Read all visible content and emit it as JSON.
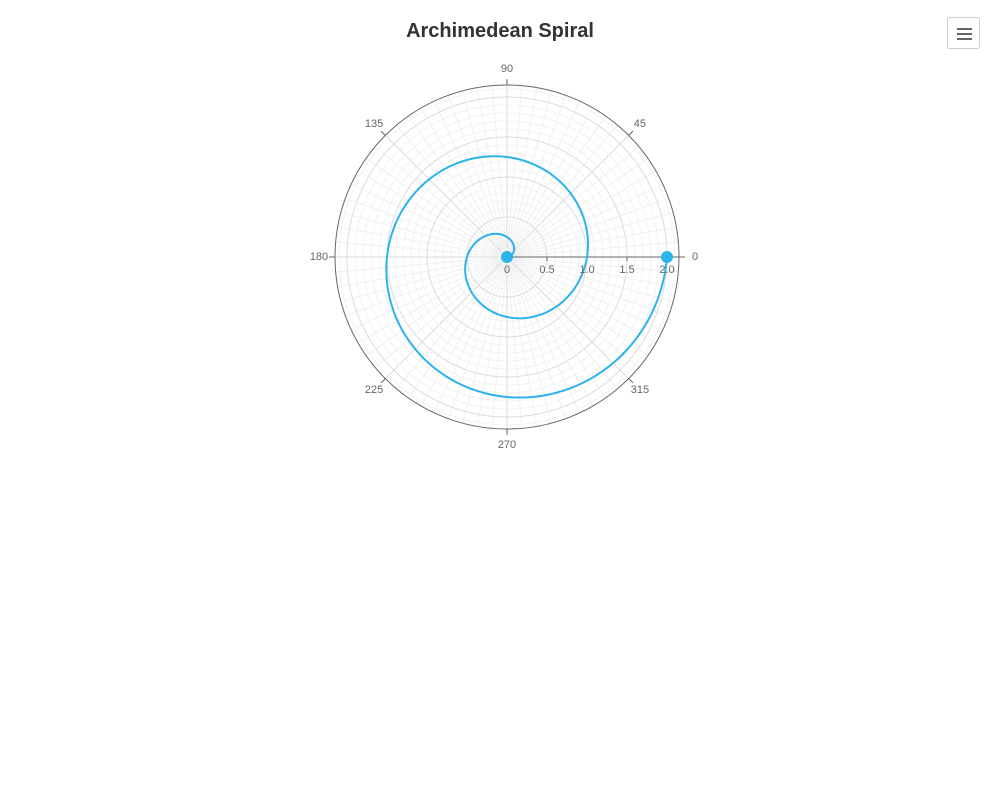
{
  "chart_data": {
    "type": "line",
    "subtype": "polar",
    "title": "Archimedean Spiral",
    "angular_axis": {
      "ticks": [
        "0",
        "45",
        "90",
        "135",
        "180",
        "225",
        "270",
        "315"
      ],
      "tick_values_deg": [
        0,
        45,
        90,
        135,
        180,
        225,
        270,
        315
      ],
      "direction": "counterclockwise",
      "zero_at": "right"
    },
    "radial_axis": {
      "ticks": [
        "0",
        "0.5",
        "1.0",
        "1.5",
        "2.0"
      ],
      "tick_values": [
        0,
        0.5,
        1.0,
        1.5,
        2.0
      ],
      "range": [
        0,
        2.15
      ]
    },
    "grid": true,
    "series": [
      {
        "formula": "r = theta / (2 * pi)",
        "theta_deg_range": [
          0,
          720
        ],
        "points": [
          {
            "theta": 0,
            "r": 0.0
          },
          {
            "theta": 90,
            "r": 0.25
          },
          {
            "theta": 180,
            "r": 0.5
          },
          {
            "theta": 270,
            "r": 0.75
          },
          {
            "theta": 360,
            "r": 1.0
          },
          {
            "theta": 450,
            "r": 1.25
          },
          {
            "theta": 540,
            "r": 1.5
          },
          {
            "theta": 630,
            "r": 1.75
          },
          {
            "theta": 720,
            "r": 2.0
          }
        ],
        "markers_at_ends": true,
        "color": "#2db3ec"
      }
    ]
  },
  "colors": {
    "series": "#2db3ec",
    "grid": "#e6e6e6",
    "outer_ring": "#666666",
    "tick_text": "#666666"
  },
  "toolbar": {
    "menu_icon": "hamburger-menu-icon"
  }
}
